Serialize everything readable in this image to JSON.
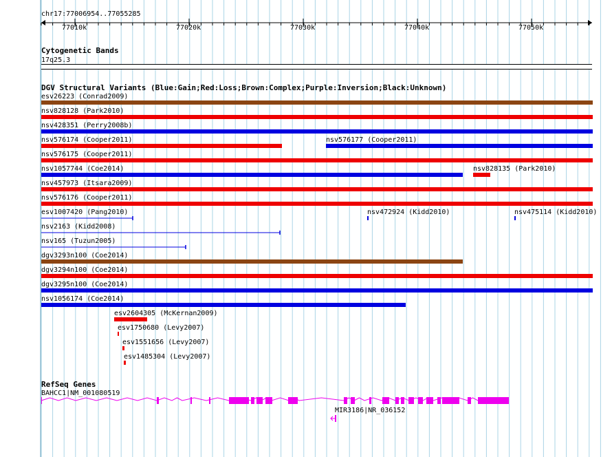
{
  "ruler": {
    "locus": "chr17:77006954..77055285",
    "ticks": [
      "77010k",
      "77020k",
      "77030k",
      "77040k",
      "77050k"
    ]
  },
  "cytobands": {
    "title": "Cytogenetic Bands",
    "band": "17q25.3"
  },
  "dgv": {
    "title": "DGV Structural Variants (Blue:Gain;Red:Loss;Brown:Complex;Purple:Inversion;Black:Unknown)",
    "colors": {
      "gain": "#0000e0",
      "loss": "#ee0000",
      "complex": "#8b4513"
    },
    "variants": [
      {
        "label": "esv26223 (Conrad2009)",
        "type": "complex"
      },
      {
        "label": "nsv828128 (Park2010)",
        "type": "loss"
      },
      {
        "label": "nsv428351 (Perry2008b)",
        "type": "gain"
      },
      {
        "label": "nsv576174 (Cooper2011)",
        "type": "loss"
      },
      {
        "label": "nsv576177 (Cooper2011)",
        "type": "gain"
      },
      {
        "label": "nsv576175 (Cooper2011)",
        "type": "loss"
      },
      {
        "label": "nsv1057744 (Coe2014)",
        "type": "gain"
      },
      {
        "label": "nsv828135 (Park2010)",
        "type": "loss"
      },
      {
        "label": "nsv457973 (Itsara2009)",
        "type": "loss"
      },
      {
        "label": "nsv576176 (Cooper2011)",
        "type": "loss"
      },
      {
        "label": "esv1007420 (Pang2010)",
        "type": "gain"
      },
      {
        "label": "nsv472924 (Kidd2010)",
        "type": "gain"
      },
      {
        "label": "nsv475114 (Kidd2010)",
        "type": "gain"
      },
      {
        "label": "nsv2163 (Kidd2008)",
        "type": "gain"
      },
      {
        "label": "nsv165 (Tuzun2005)",
        "type": "gain"
      },
      {
        "label": "dgv3293n100 (Coe2014)",
        "type": "complex"
      },
      {
        "label": "dgv3294n100 (Coe2014)",
        "type": "loss"
      },
      {
        "label": "dgv3295n100 (Coe2014)",
        "type": "gain"
      },
      {
        "label": "nsv1056174 (Coe2014)",
        "type": "gain"
      },
      {
        "label": "esv2604305 (McKernan2009)",
        "type": "loss"
      },
      {
        "label": "esv1750680 (Levy2007)",
        "type": "loss"
      },
      {
        "label": "esv1551656 (Levy2007)",
        "type": "loss"
      },
      {
        "label": "esv1485304 (Levy2007)",
        "type": "loss"
      }
    ]
  },
  "refseq": {
    "title": "RefSeq Genes",
    "color": "#ee00ee",
    "genes": [
      {
        "label": "BAHCC1|NM_001080519"
      },
      {
        "label": "MIR3186|NR_036152"
      }
    ]
  }
}
